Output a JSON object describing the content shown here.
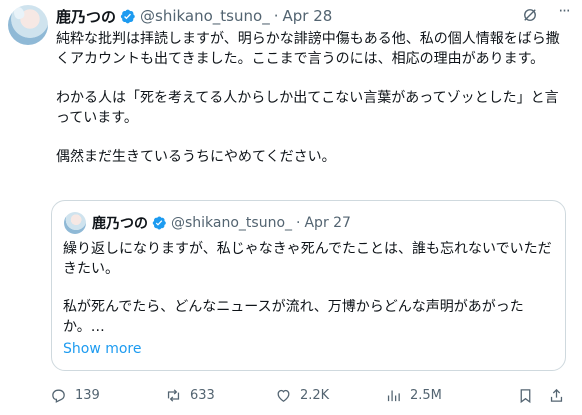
{
  "tweet": {
    "name": "鹿乃つの",
    "handle": "@shikano_tsuno_",
    "separator": "·",
    "date": "Apr 28",
    "more": "···",
    "paragraphs": [
      "純粋な批判は拝読しますが、明らかな誹謗中傷もある他、私の個人情報をばら撒くアカウントも出てきました。ここまで言うのには、相応の理由があります。",
      "わかる人は「死を考えてる人からしか出てこない言葉があってゾッとした」と言っています。",
      "偶然まだ生きているうちにやめてください。"
    ]
  },
  "quote": {
    "name": "鹿乃つの",
    "handle": "@shikano_tsuno_",
    "separator": "·",
    "date": "Apr 27",
    "paragraphs": [
      "繰り返しになりますが、私じゃなきゃ死んでたことは、誰も忘れないでいただきたい。",
      "私が死んでたら、どんなニュースが流れ、万博からどんな声明があがったか。…"
    ],
    "show_more": "Show more"
  },
  "actions": {
    "replies": "139",
    "reposts": "633",
    "likes": "2.2K",
    "views": "2.5M"
  },
  "colors": {
    "verified": "#1d9bf0",
    "link": "#1d9bf0",
    "muted": "#536471",
    "border": "#cfd9de"
  }
}
